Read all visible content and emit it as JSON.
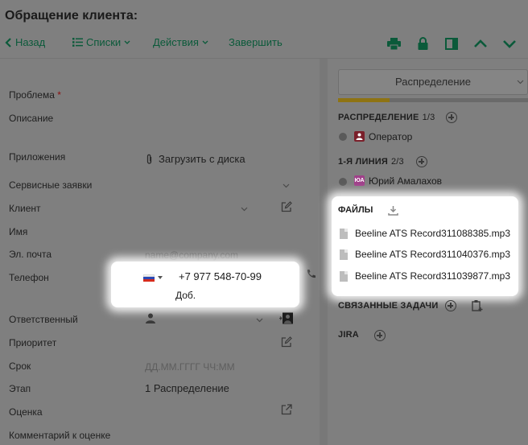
{
  "header": {
    "title": "Обращение клиента:",
    "back_label": "Назад",
    "lists_label": "Списки",
    "actions_label": "Действия",
    "finish_label": "Завершить"
  },
  "form": {
    "problem_label": "Проблема",
    "required_mark": "*",
    "description_label": "Описание",
    "attachments_label": "Приложения",
    "upload_label": "Загрузить с диска",
    "service_requests_label": "Сервисные заявки",
    "client_label": "Клиент",
    "name_label": "Имя",
    "email_label": "Эл. почта",
    "email_placeholder": "name@company.com",
    "phone_label": "Телефон",
    "phone_value": "+7 977 548-70-99",
    "extension_label": "Доб.",
    "responsible_label": "Ответственный",
    "priority_label": "Приоритет",
    "deadline_label": "Срок",
    "deadline_placeholder": "ДД.ММ.ГГГГ ЧЧ:ММ",
    "stage_label": "Этап",
    "stage_value": "1 Распределение",
    "rating_label": "Оценка",
    "rating_comment_label": "Комментарий к оценке"
  },
  "panel": {
    "stage_select": "Распределение",
    "progress_fraction": 0.27,
    "distribution": {
      "title": "РАСПРЕДЕЛЕНИЕ",
      "count": "1/3",
      "member": "Оператор"
    },
    "first_line": {
      "title": "1-Я ЛИНИЯ",
      "count": "2/3",
      "member": "Юрий Амалахов",
      "avatar_initials": "ЮА"
    },
    "files": {
      "title": "ФАЙЛЫ",
      "items": [
        "Beeline ATS Record311088385.mp3",
        "Beeline ATS Record311040376.mp3",
        "Beeline ATS Record311039877.mp3"
      ]
    },
    "related_tasks_title": "СВЯЗАННЫЕ ЗАДАЧИ",
    "jira_title": "JIRA"
  },
  "colors": {
    "accent_green": "#0b5a3a",
    "progress": "#8e7313",
    "avatar_red": "#7a1f2a",
    "avatar_pink": "#a0408a"
  }
}
